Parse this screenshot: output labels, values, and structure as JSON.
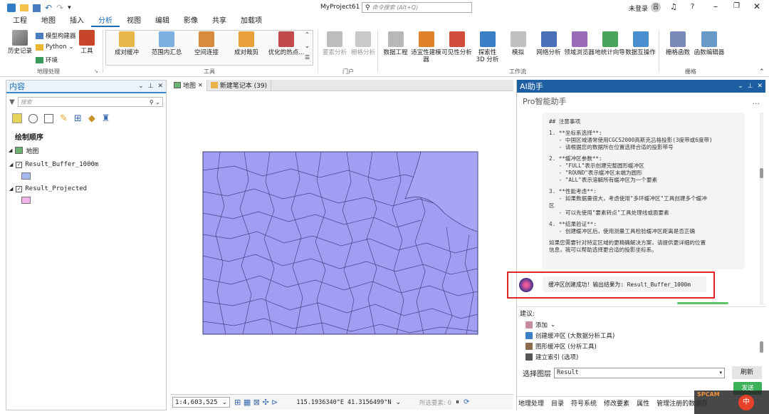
{
  "titlebar": {
    "project": "MyProject61",
    "search_placeholder": "命令搜索 (Alt+Q)",
    "login": "未登录",
    "help": "?"
  },
  "menu": {
    "tabs": [
      "工程",
      "地图",
      "插入",
      "分析",
      "视图",
      "编辑",
      "影像",
      "共享",
      "加载项"
    ],
    "active_index": 3
  },
  "ribbon": {
    "geoprocessing": {
      "history": "历史记录",
      "modelbuilder": "模型构建器",
      "python": "Python",
      "env": "环境",
      "tools": "工具",
      "group": "地理处理"
    },
    "tools_gallery": {
      "items": [
        "成对缓冲",
        "范围内汇总",
        "空间连接",
        "成对裁剪",
        "优化的热点..."
      ],
      "group": "工具"
    },
    "portal": {
      "items": [
        "要素分析",
        "栅格分析"
      ],
      "group": "门户"
    },
    "workflow": {
      "items": [
        "数据工程",
        "适宜性建模器",
        "可见性分析",
        "探索性\n3D 分析",
        "模拟",
        "网络分析",
        "领域浏览器",
        "地统计向导",
        "数据互操作"
      ],
      "group": "工作流"
    },
    "raster": {
      "items": [
        "栅格函数",
        "函数编辑器"
      ],
      "group": "栅格"
    }
  },
  "contents": {
    "title": "内容",
    "search_placeholder": "搜索",
    "draw_order": "绘制顺序",
    "map": "地图",
    "layers": [
      {
        "name": "Result_Buffer_1000m",
        "color": "#a6b8f0",
        "checked": true
      },
      {
        "name": "Result_Projected",
        "color": "#f2b6ea",
        "checked": true
      }
    ]
  },
  "map_view": {
    "tabs": [
      "地图",
      "新建笔记本 (39)"
    ],
    "scale": "1:4,603,525",
    "coords": "115.1936340°E 41.3156499°N",
    "selected": "所选要素: 0",
    "fill_color": "#9f9ef2"
  },
  "ai": {
    "title": "AI助手",
    "subtitle": "Pro智能助手",
    "more": "...",
    "message_lines": [
      "## 注意事项",
      "",
      "1. **坐标系选择**:",
      "   - 中国区域通常使用CGCS2000高斯克吕格投影(3度带或6度带)",
      "   - 请根据您的数据所在位置选择合适的投影带号",
      "",
      "2. **缓冲区参数**:",
      "   - \"FULL\"表示创建完整圆形缓冲区",
      "   - \"ROUND\"表示缓冲区末端为圆形",
      "   - \"ALL\"表示溶解所有缓冲区为一个要素",
      "",
      "3. **性能考虑**:",
      "   - 如果数据量很大，考虑使用\"多环缓冲区\"工具创建多个缓冲",
      "区",
      "   - 可以先使用\"要素转点\"工具处理线或面要素",
      "",
      "4. **结果验证**:",
      "   - 创建缓冲区后，使用测量工具检验缓冲区距离是否正确",
      "",
      "如果您需要针对特定区域的更精确解决方案，请提供更详细的位置",
      "信息，我可以帮助选择更合适的投影坐标系。"
    ],
    "result_message": "缓冲区创建成功！输出结果为: Result_Buffer_1000m",
    "suggest_label": "建议:",
    "suggestions": [
      "添加",
      "创建缓冲区 (大数据分析工具)",
      "图形缓冲区 (分析工具)",
      "建立索引 (选项)"
    ],
    "layer_label": "选择图层",
    "layer_value": "Result",
    "refresh": "刷新",
    "send": "发送",
    "bottom_tabs": [
      "地理处理",
      "目录",
      "符号系统",
      "修改要素",
      "属性",
      "管理注册的数据存"
    ]
  },
  "watermark": "SPCAM"
}
